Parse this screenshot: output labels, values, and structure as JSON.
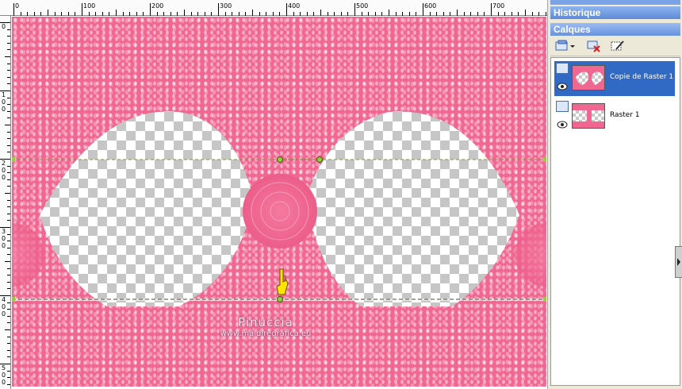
{
  "rulers": {
    "top_labels": [
      "0",
      "100",
      "200",
      "300",
      "400",
      "500",
      "600",
      "700"
    ],
    "left_labels": [
      "0",
      "1\n0\n0",
      "2\n0\n0",
      "3\n0\n0",
      "4\n0\n0",
      "5\n0\n0"
    ]
  },
  "watermark": {
    "line1": "Pinuccia",
    "line2": "www.maidiregrafica.eu"
  },
  "panel": {
    "historique_title": "Historique",
    "calques_title": "Calques",
    "layers": [
      {
        "name": "Copie de Raster 1",
        "selected": true
      },
      {
        "name": "Raster 1",
        "selected": false
      }
    ]
  },
  "colors": {
    "pattern_pink": "#f06792",
    "selection_blue": "#316ac5",
    "panel_header": "#6b93dc"
  },
  "icons": [
    "new-layer-icon",
    "delete-layer-icon",
    "properties-icon",
    "eye-icon",
    "layer-type-icon",
    "pick-hand-icon"
  ]
}
